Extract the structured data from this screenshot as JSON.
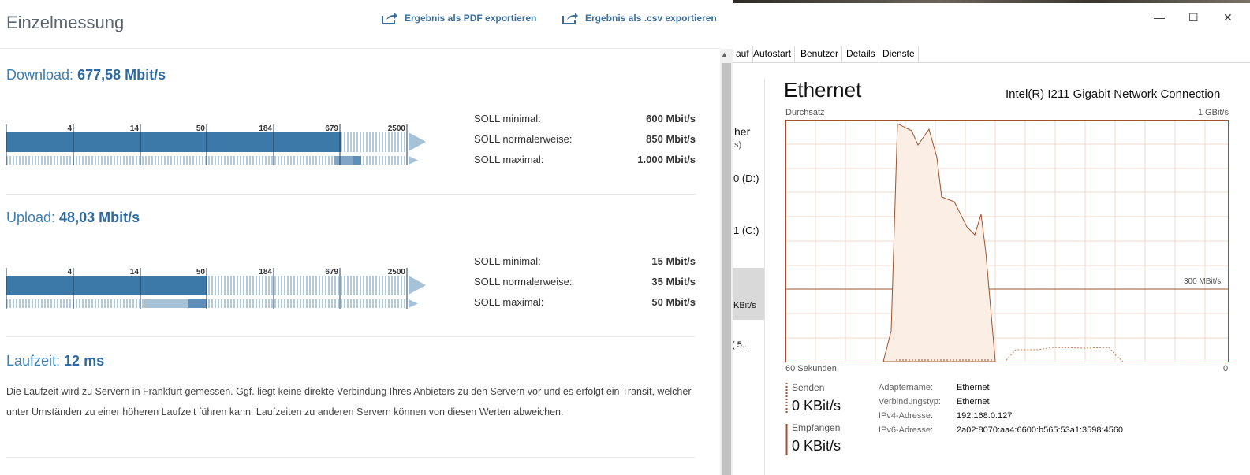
{
  "web": {
    "title": "Einzelmessung",
    "export_pdf": "Ergebnis als PDF exportieren",
    "export_csv": "Ergebnis als .csv exportieren",
    "download": {
      "label": "Download: ",
      "value": "677,58 Mbit/s",
      "scale": [
        "4",
        "14",
        "50",
        "184",
        "679",
        "2500"
      ],
      "soll": [
        {
          "k": "SOLL minimal:",
          "v": "600 Mbit/s"
        },
        {
          "k": "SOLL normalerweise:",
          "v": "850 Mbit/s"
        },
        {
          "k": "SOLL maximal:",
          "v": "1.000 Mbit/s"
        }
      ]
    },
    "upload": {
      "label": "Upload: ",
      "value": "48,03 Mbit/s",
      "scale": [
        "4",
        "14",
        "50",
        "184",
        "679",
        "2500"
      ],
      "soll": [
        {
          "k": "SOLL minimal:",
          "v": "15 Mbit/s"
        },
        {
          "k": "SOLL normalerweise:",
          "v": "35 Mbit/s"
        },
        {
          "k": "SOLL maximal:",
          "v": "50 Mbit/s"
        }
      ]
    },
    "latency": {
      "label": "Laufzeit: ",
      "value": "12 ms",
      "text": "Die Laufzeit wird zu Servern in Frankfurt gemessen. Ggf. liegt keine direkte Verbindung Ihres Anbieters zu den Servern vor und es erfolgt ein Transit, welcher unter Umständen zu einer höheren Laufzeit führen kann. Laufzeiten zu anderen Servern können von diesen Werten abweichen."
    }
  },
  "taskmgr": {
    "tabs": [
      "auf",
      "Autostart",
      "Benutzer",
      "Details",
      "Dienste"
    ],
    "nav": [
      "her",
      "s)",
      "0 (D:)",
      "1 (C:)",
      "KBit/s",
      "( 5..."
    ],
    "heading": "Ethernet",
    "adapter": "Intel(R) I211 Gigabit Network Connection",
    "graph_label": "Durchsatz",
    "graph_max": "1 GBit/s",
    "graph_mid": "300 MBit/s",
    "graph_time": "60 Sekunden",
    "graph_zero": "0",
    "send_label": "Senden",
    "send_value": "0 KBit/s",
    "recv_label": "Empfangen",
    "recv_value": "0 KBit/s",
    "info": [
      {
        "k": "Adaptername:",
        "v": "Ethernet"
      },
      {
        "k": "Verbindungstyp:",
        "v": "Ethernet"
      },
      {
        "k": "IPv4-Adresse:",
        "v": "192.168.0.127"
      },
      {
        "k": "IPv6-Adresse:",
        "v": "2a02:8070:aa4:6600:b565:53a1:3598:4560"
      }
    ]
  },
  "colors": {
    "accent": "#3a6e9c",
    "bar": "#3d79a8",
    "graph": "#a0522d"
  }
}
